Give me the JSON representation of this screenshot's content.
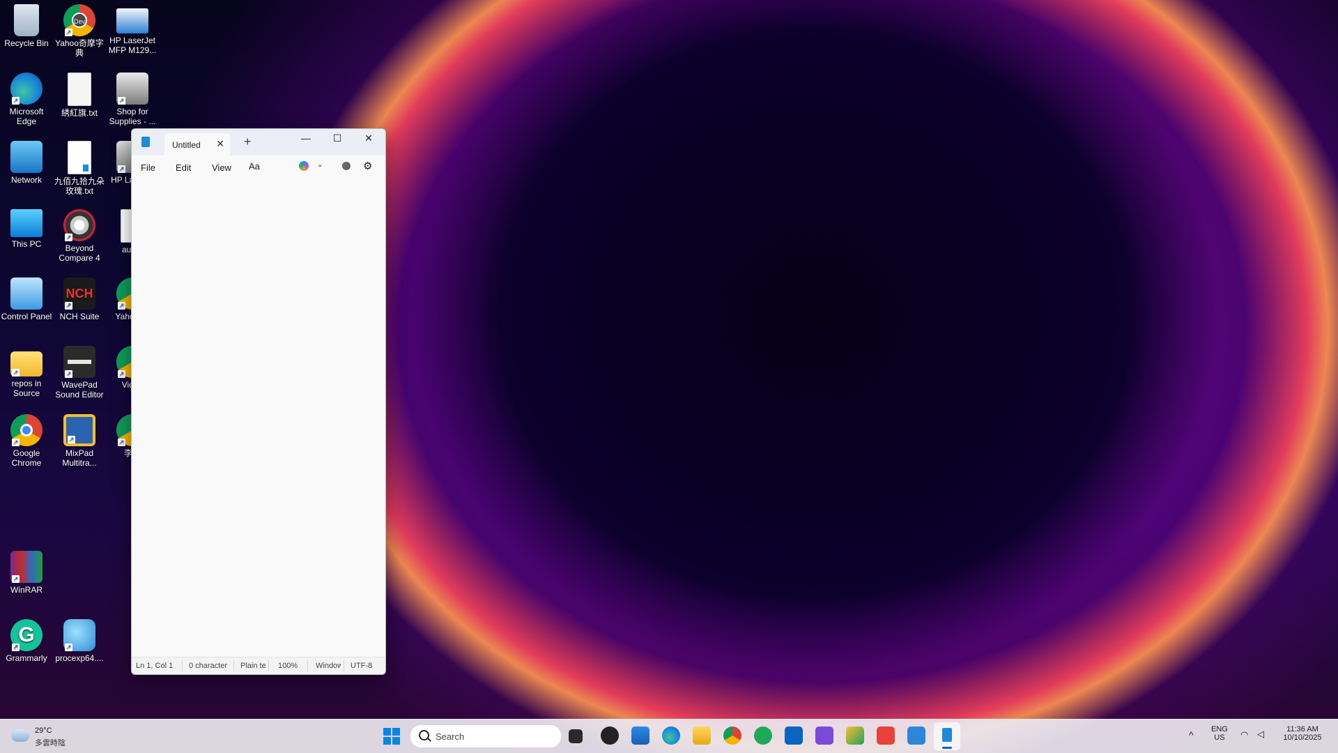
{
  "desktop": {
    "icons": [
      {
        "label": "Recycle Bin",
        "icon": "recycle-bin-icon"
      },
      {
        "label": "Yahoo奇摩字典",
        "icon": "chrome-dev-icon"
      },
      {
        "label": "HP LaserJet MFP M129...",
        "icon": "scanner-icon"
      },
      {
        "label": "Microsoft Edge",
        "icon": "edge-icon"
      },
      {
        "label": "綉紅旗.txt",
        "icon": "text-file-icon"
      },
      {
        "label": "Shop for Supplies - ...",
        "icon": "printer-shop-icon"
      },
      {
        "label": "Network",
        "icon": "network-icon"
      },
      {
        "label": "九佰九拾九朵玫瑰.txt",
        "icon": "text-file-icon"
      },
      {
        "label": "HP La MFP",
        "icon": "printer-icon"
      },
      {
        "label": "This PC",
        "icon": "pc-icon"
      },
      {
        "label": "Beyond Compare 4",
        "icon": "beyond-compare-icon"
      },
      {
        "label": "autoe",
        "icon": "file-icon"
      },
      {
        "label": "Control Panel",
        "icon": "control-panel-icon"
      },
      {
        "label": "NCH Suite",
        "icon": "nch-icon"
      },
      {
        "label": "Yahoo 典",
        "icon": "chrome-icon"
      },
      {
        "label": "repos in Source",
        "icon": "folder-icon"
      },
      {
        "label": "WavePad Sound Editor",
        "icon": "wavepad-icon"
      },
      {
        "label": "Video",
        "icon": "chrome-icon"
      },
      {
        "label": "Google Chrome",
        "icon": "chrome-icon"
      },
      {
        "label": "MixPad Multitra...",
        "icon": "mixpad-icon"
      },
      {
        "label": "李小",
        "icon": "chrome-icon"
      },
      {
        "label": "WinRAR",
        "icon": "winrar-icon"
      },
      {
        "label": "Grammarly",
        "icon": "grammarly-icon"
      },
      {
        "label": "procexp64....",
        "icon": "procexp-icon"
      }
    ]
  },
  "notepad": {
    "tab_title": "Untitled",
    "new_tab": "+",
    "menu": {
      "file": "File",
      "edit": "Edit",
      "view": "View"
    },
    "status": {
      "position": "Ln 1, Col 1",
      "characters": "0 character",
      "format": "Plain text",
      "zoom": "100%",
      "line_ending": "Windows (CRLF)",
      "encoding": "UTF-8"
    }
  },
  "taskbar": {
    "weather_temp": "29°C",
    "weather_desc": "多雲時陰",
    "search_placeholder": "Search",
    "lang_top": "ENG",
    "lang_bottom": "US",
    "time": "11:36 AM",
    "date": "10/10/2025"
  },
  "colors": {
    "accent": "#0067c0",
    "notepad_icon": "#1e8ad8"
  }
}
